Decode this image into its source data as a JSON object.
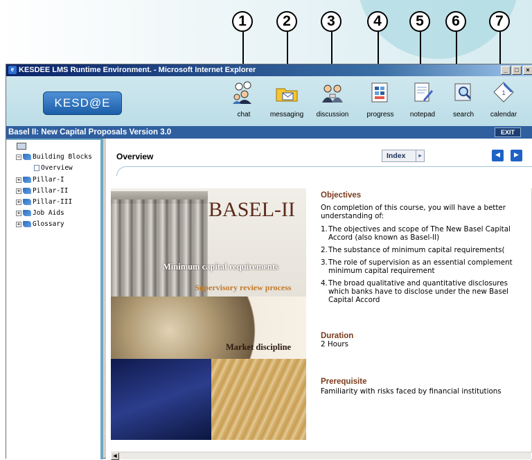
{
  "callouts": [
    "1",
    "2",
    "3",
    "4",
    "5",
    "6",
    "7"
  ],
  "window": {
    "title": "KESDEE LMS Runtime Environment. - Microsoft Internet Explorer",
    "minimize": "_",
    "maximize": "□",
    "close": "×"
  },
  "header": {
    "logo": "KESD@E",
    "tools": [
      {
        "label": "chat",
        "icon": "chat-icon"
      },
      {
        "label": "messaging",
        "icon": "messaging-icon"
      },
      {
        "label": "discussion",
        "icon": "discussion-icon"
      },
      {
        "label": "progress",
        "icon": "progress-icon"
      },
      {
        "label": "notepad",
        "icon": "notepad-icon"
      },
      {
        "label": "search",
        "icon": "search-icon"
      },
      {
        "label": "calendar",
        "icon": "calendar-icon"
      }
    ]
  },
  "course_bar": {
    "title": "Basel II: New Capital Proposals Version 3.0",
    "exit": "EXIT"
  },
  "tree": {
    "items": [
      {
        "label": "Building Blocks",
        "icon": "book-open-icon"
      },
      {
        "label": "Overview",
        "icon": "document-icon"
      },
      {
        "label": "Pillar-I",
        "icon": "book-icon"
      },
      {
        "label": "Pillar-II",
        "icon": "book-icon"
      },
      {
        "label": "Pillar-III",
        "icon": "book-icon"
      },
      {
        "label": "Job Aids",
        "icon": "book-icon"
      },
      {
        "label": "Glossary",
        "icon": "book-icon"
      }
    ]
  },
  "content": {
    "section_title": "Overview",
    "index_button": "Index",
    "poster": {
      "title": "BASEL-II",
      "line1": "Minimum capital requirements",
      "line2": "Supervisory review process",
      "line3": "Market discipline"
    },
    "objectives": {
      "heading": "Objectives",
      "intro": "On completion of this course, you will have a better understanding of:",
      "items": [
        "The objectives and scope of The New Basel Capital Accord (also known as Basel-II)",
        "The substance of minimum capital requirements(",
        "The role of supervision as an essential complement minimum capital requirement",
        "The broad qualitative and quantitative disclosures which banks have to disclose under the new Basel Capital Accord"
      ]
    },
    "duration": {
      "heading": "Duration",
      "value": "2 Hours"
    },
    "prerequisite": {
      "heading": "Prerequisite",
      "value": "Familiarity with risks faced by financial institutions"
    }
  }
}
